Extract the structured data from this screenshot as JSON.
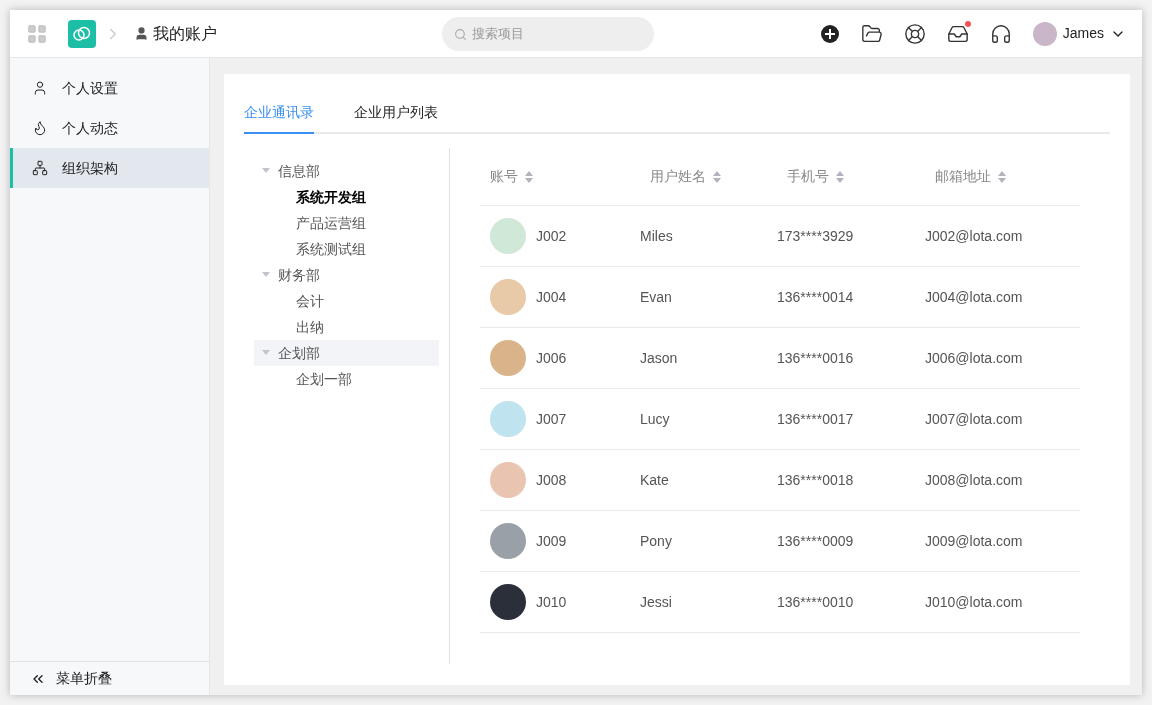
{
  "header": {
    "breadcrumb": "我的账户",
    "search": {
      "placeholder": "搜索项目"
    },
    "inbox_notification": true,
    "user": {
      "name": "James"
    }
  },
  "sidebar": {
    "items": [
      {
        "label": "个人设置",
        "selected": false
      },
      {
        "label": "个人动态",
        "selected": false
      },
      {
        "label": "组织架构",
        "selected": true
      }
    ],
    "collapse": "菜单折叠"
  },
  "tabs": [
    {
      "label": "企业通讯录",
      "selected": true
    },
    {
      "label": "企业用户列表",
      "selected": false
    }
  ],
  "tree": [
    {
      "label": "信息部",
      "expanded": true,
      "selected": false,
      "hovered": false,
      "children": [
        {
          "label": "系统开发组",
          "selected": true,
          "hovered": false
        },
        {
          "label": "产品运营组",
          "selected": false,
          "hovered": false
        },
        {
          "label": "系统测试组",
          "selected": false,
          "hovered": false
        }
      ]
    },
    {
      "label": "财务部",
      "expanded": true,
      "selected": false,
      "hovered": false,
      "children": [
        {
          "label": "会计",
          "selected": false,
          "hovered": false
        },
        {
          "label": "出纳",
          "selected": false,
          "hovered": false
        }
      ]
    },
    {
      "label": "企划部",
      "expanded": true,
      "selected": false,
      "hovered": true,
      "children": [
        {
          "label": "企划一部",
          "selected": false,
          "hovered": false
        }
      ]
    }
  ],
  "table": {
    "columns": [
      "账号",
      "用户姓名",
      "手机号",
      "邮箱地址"
    ],
    "rows": [
      {
        "account": "J002",
        "name": "Miles",
        "phone": "173****3929",
        "email": "J002@lota.com"
      },
      {
        "account": "J004",
        "name": "Evan",
        "phone": "136****0014",
        "email": "J004@lota.com"
      },
      {
        "account": "J006",
        "name": "Jason",
        "phone": "136****0016",
        "email": "J006@lota.com"
      },
      {
        "account": "J007",
        "name": "Lucy",
        "phone": "136****0017",
        "email": "J007@lota.com"
      },
      {
        "account": "J008",
        "name": "Kate",
        "phone": "136****0018",
        "email": "J008@lota.com"
      },
      {
        "account": "J009",
        "name": "Pony",
        "phone": "136****0009",
        "email": "J009@lota.com"
      },
      {
        "account": "J010",
        "name": "Jessi",
        "phone": "136****0010",
        "email": "J010@lota.com"
      }
    ]
  }
}
